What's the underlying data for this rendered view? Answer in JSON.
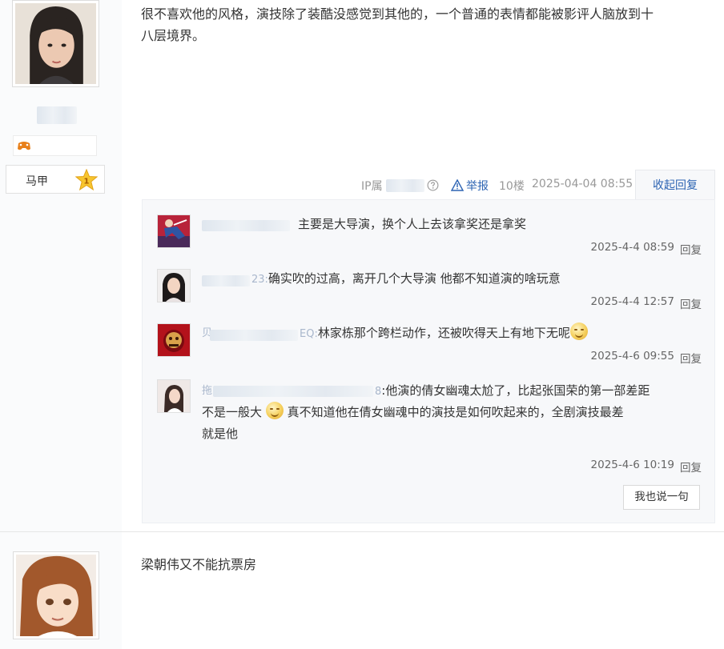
{
  "post1": {
    "author": {
      "level_badge": "1"
    },
    "majia_label": "马甲",
    "body_lines": [
      "很不喜欢他的风格，演技除了装酷没感觉到其他的，一个普通的表情都能被影评人脑放到十",
      "八层境界。"
    ],
    "meta": {
      "ip_prefix": "IP属",
      "report_label": "举报",
      "floor": "10楼",
      "time": "2025-04-04 08:55",
      "collapse_label": "收起回复"
    },
    "replies": [
      {
        "name_tail": "",
        "text": "主要是大导演，换个人上去该拿奖还是拿奖",
        "time": "2025-4-4 08:59",
        "reply_label": "回复"
      },
      {
        "name_tail": "23:",
        "text": "确实吹的过高，离开几个大导演 他都不知道演的啥玩意",
        "time": "2025-4-4 12:57",
        "reply_label": "回复"
      },
      {
        "name_head": "贝",
        "name_tail": "EQ:",
        "text": "林家栋那个跨栏动作，还被吹得天上有地下无呢",
        "time": "2025-4-6 09:55",
        "reply_label": "回复"
      },
      {
        "name_head": "拖",
        "name_tail": "8",
        "text_line1": ":他演的倩女幽魂太尬了，比起张国荣的第一部差距",
        "text_line2a": "不是一般大",
        "text_line2b": "真不知道他在倩女幽魂中的演技是如何吹起来的，全剧演技最差",
        "text_line3": "就是他",
        "time": "2025-4-6 10:19",
        "reply_label": "回复"
      }
    ],
    "say_button": "我也说一句"
  },
  "post2": {
    "body": "梁朝伟又不能抗票房"
  },
  "colors": {
    "link": "#2d64b3",
    "reply_bg": "#f7f8fa",
    "sidebar_bg": "#fafbfc"
  },
  "icons": [
    "help-circle-icon",
    "warning-triangle-icon",
    "level-star-icon",
    "level-game-icon",
    "smile-emoji-icon"
  ]
}
